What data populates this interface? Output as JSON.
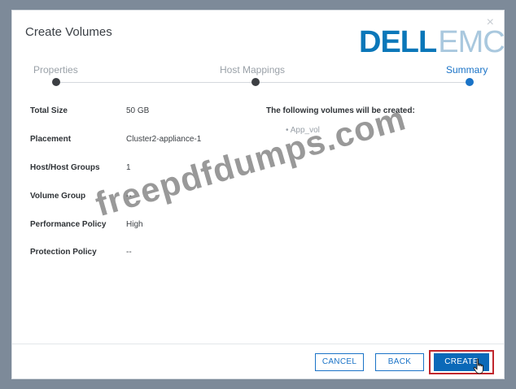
{
  "dialog": {
    "title": "Create Volumes",
    "close_glyph": "×",
    "logo": {
      "dell": "DELL",
      "emc": "EMC"
    }
  },
  "steps": [
    {
      "label": "Properties",
      "state": "complete"
    },
    {
      "label": "Host Mappings",
      "state": "complete"
    },
    {
      "label": "Summary",
      "state": "active"
    }
  ],
  "summary": {
    "rows": [
      {
        "key": "Total Size",
        "value": "50 GB"
      },
      {
        "key": "Placement",
        "value": "Cluster2-appliance-1"
      },
      {
        "key": "Host/Host Groups",
        "value": "1"
      },
      {
        "key": "Volume Group",
        "value": "--"
      },
      {
        "key": "Performance Policy",
        "value": "High"
      },
      {
        "key": "Protection Policy",
        "value": "--"
      }
    ],
    "created_heading": "The following volumes will be created:",
    "created_items": [
      "• App_vol"
    ]
  },
  "footer": {
    "cancel_label": "CANCEL",
    "back_label": "BACK",
    "create_label": "CREATE"
  },
  "watermark": "freepdfdumps.com",
  "colors": {
    "accent": "#1a73c7",
    "primary_button": "#0b69b8",
    "highlight": "#c0272d",
    "backdrop": "#7d8a99"
  }
}
